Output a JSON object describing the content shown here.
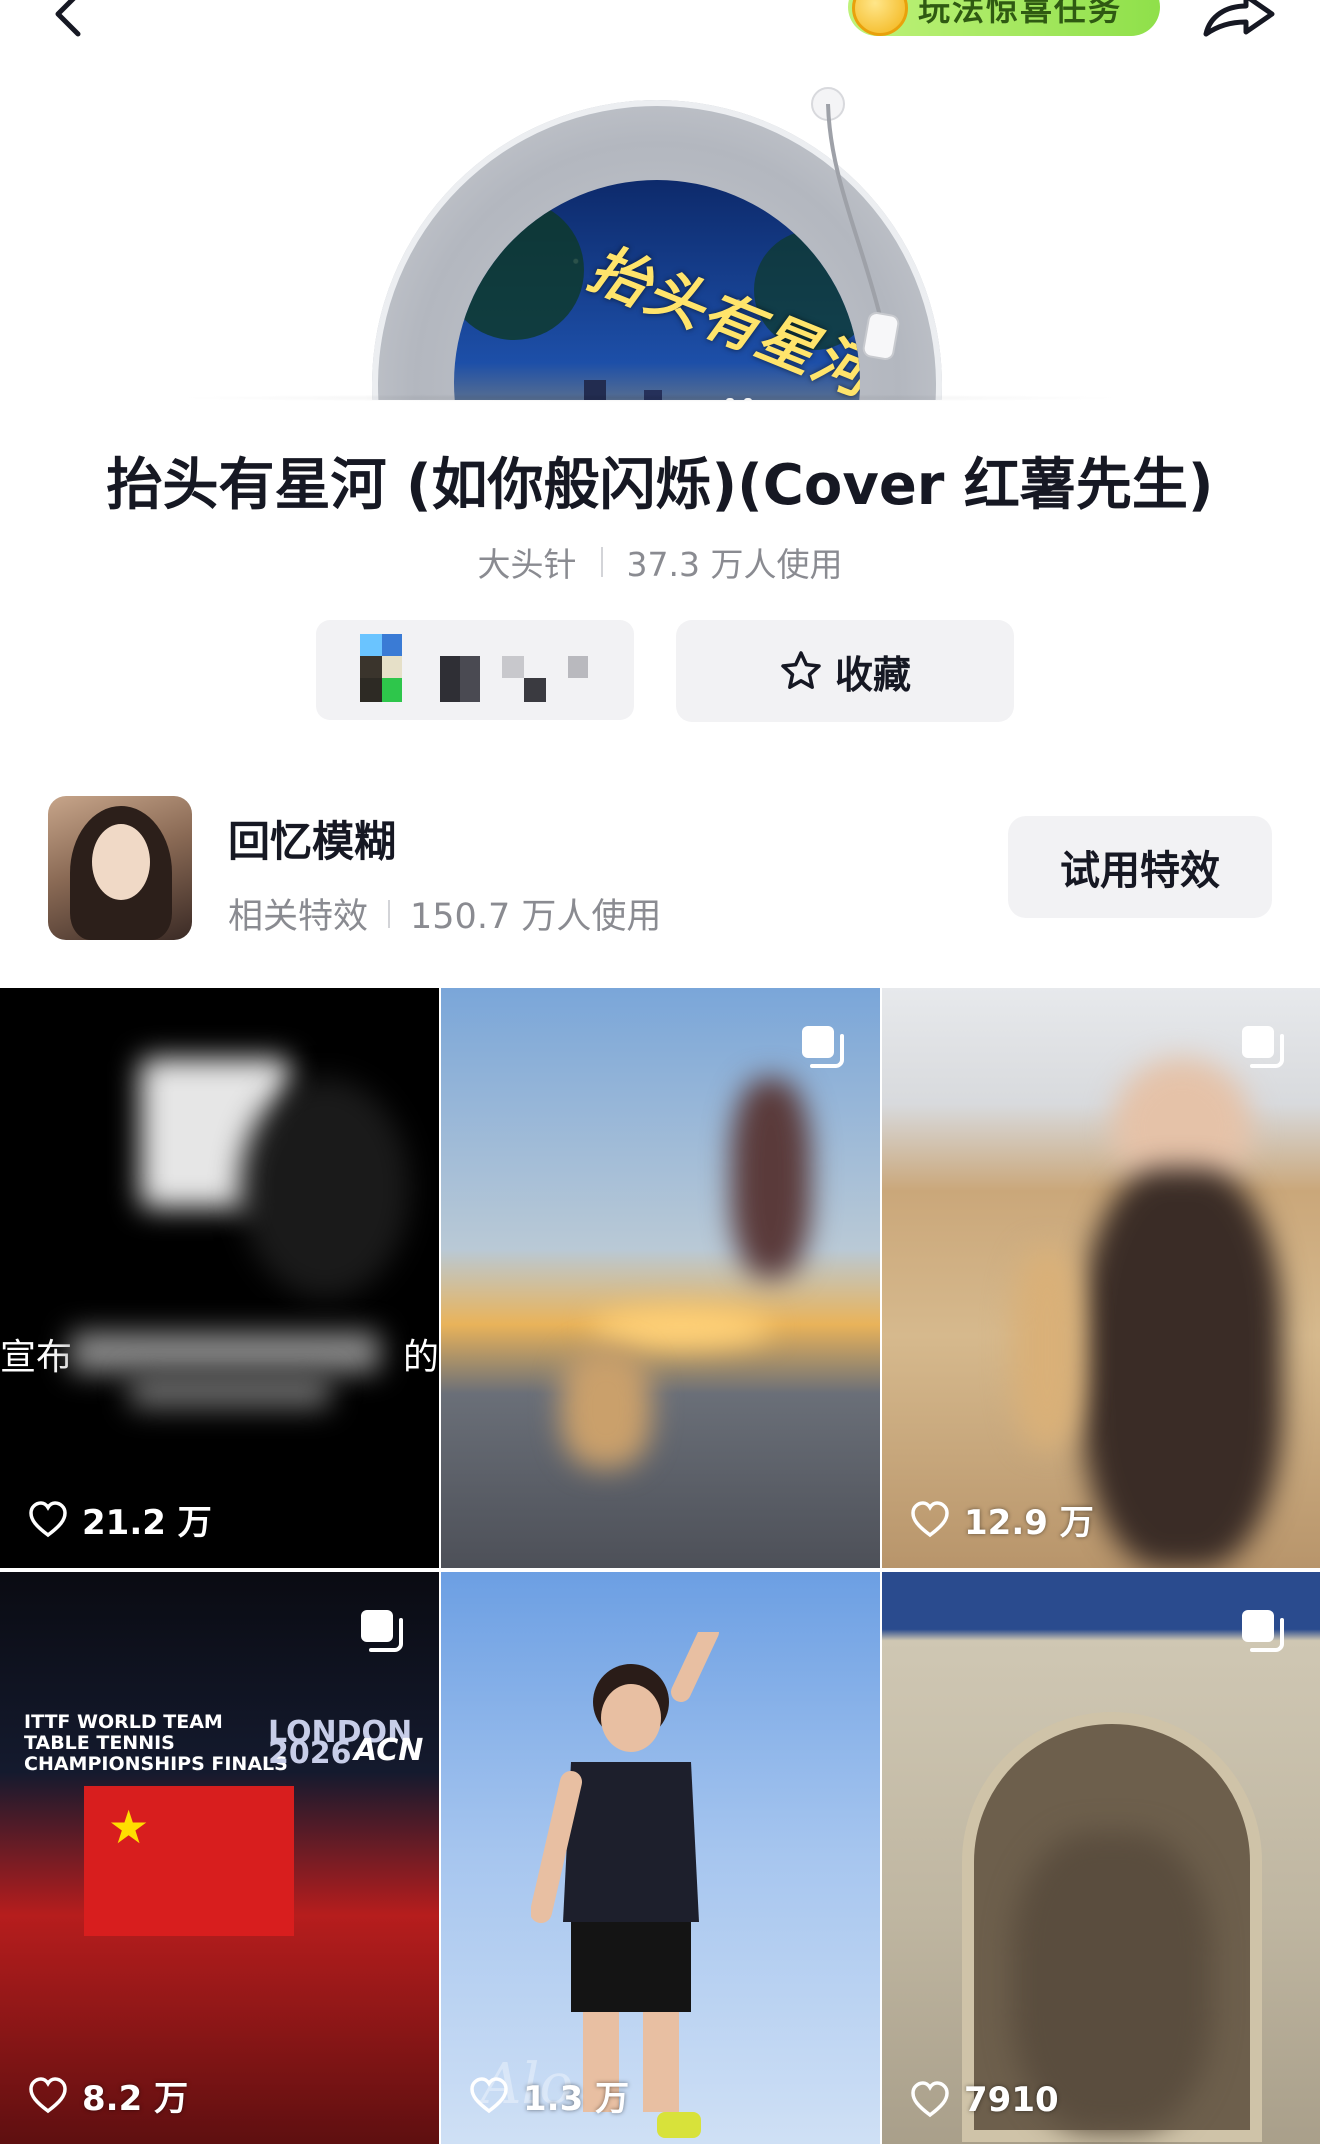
{
  "header": {
    "back_icon": "chevron-left-icon",
    "task_label": "玩法惊喜任务",
    "share_icon": "share-arrow-icon"
  },
  "song": {
    "title": "抬头有星河 (如你般闪烁)(Cover 红薯先生)",
    "cover_text": "抬头有星河",
    "author": "大头针",
    "usage": "37.3 万人使用",
    "state": "playing"
  },
  "actions": {
    "favorite_label": "收藏",
    "favorite_icon": "star-outline-icon"
  },
  "effect": {
    "name": "回忆模糊",
    "category": "相关特效",
    "usage": "150.7 万人使用",
    "try_label": "试用特效"
  },
  "videos": [
    {
      "likes": "21.2 万",
      "caption_start": "宣布",
      "caption_end": "的",
      "multi": false
    },
    {
      "likes": "",
      "multi": true
    },
    {
      "likes": "12.9 万",
      "multi": true
    },
    {
      "likes": "8.2 万",
      "multi": true,
      "banner_line1": "ITTF WORLD TEAM",
      "banner_line2": "TABLE TENNIS",
      "banner_line3": "CHAMPIONSHIPS FINALS",
      "banner_event": "LONDON 2026",
      "banner_sponsor": "ACN"
    },
    {
      "likes": "1.3 万",
      "multi": false
    },
    {
      "likes": "7910",
      "multi": true
    }
  ],
  "colors": {
    "text_primary": "#161823",
    "text_secondary": "#8a8b91",
    "button_bg": "#f2f2f4",
    "task_pill": "#9be454"
  }
}
